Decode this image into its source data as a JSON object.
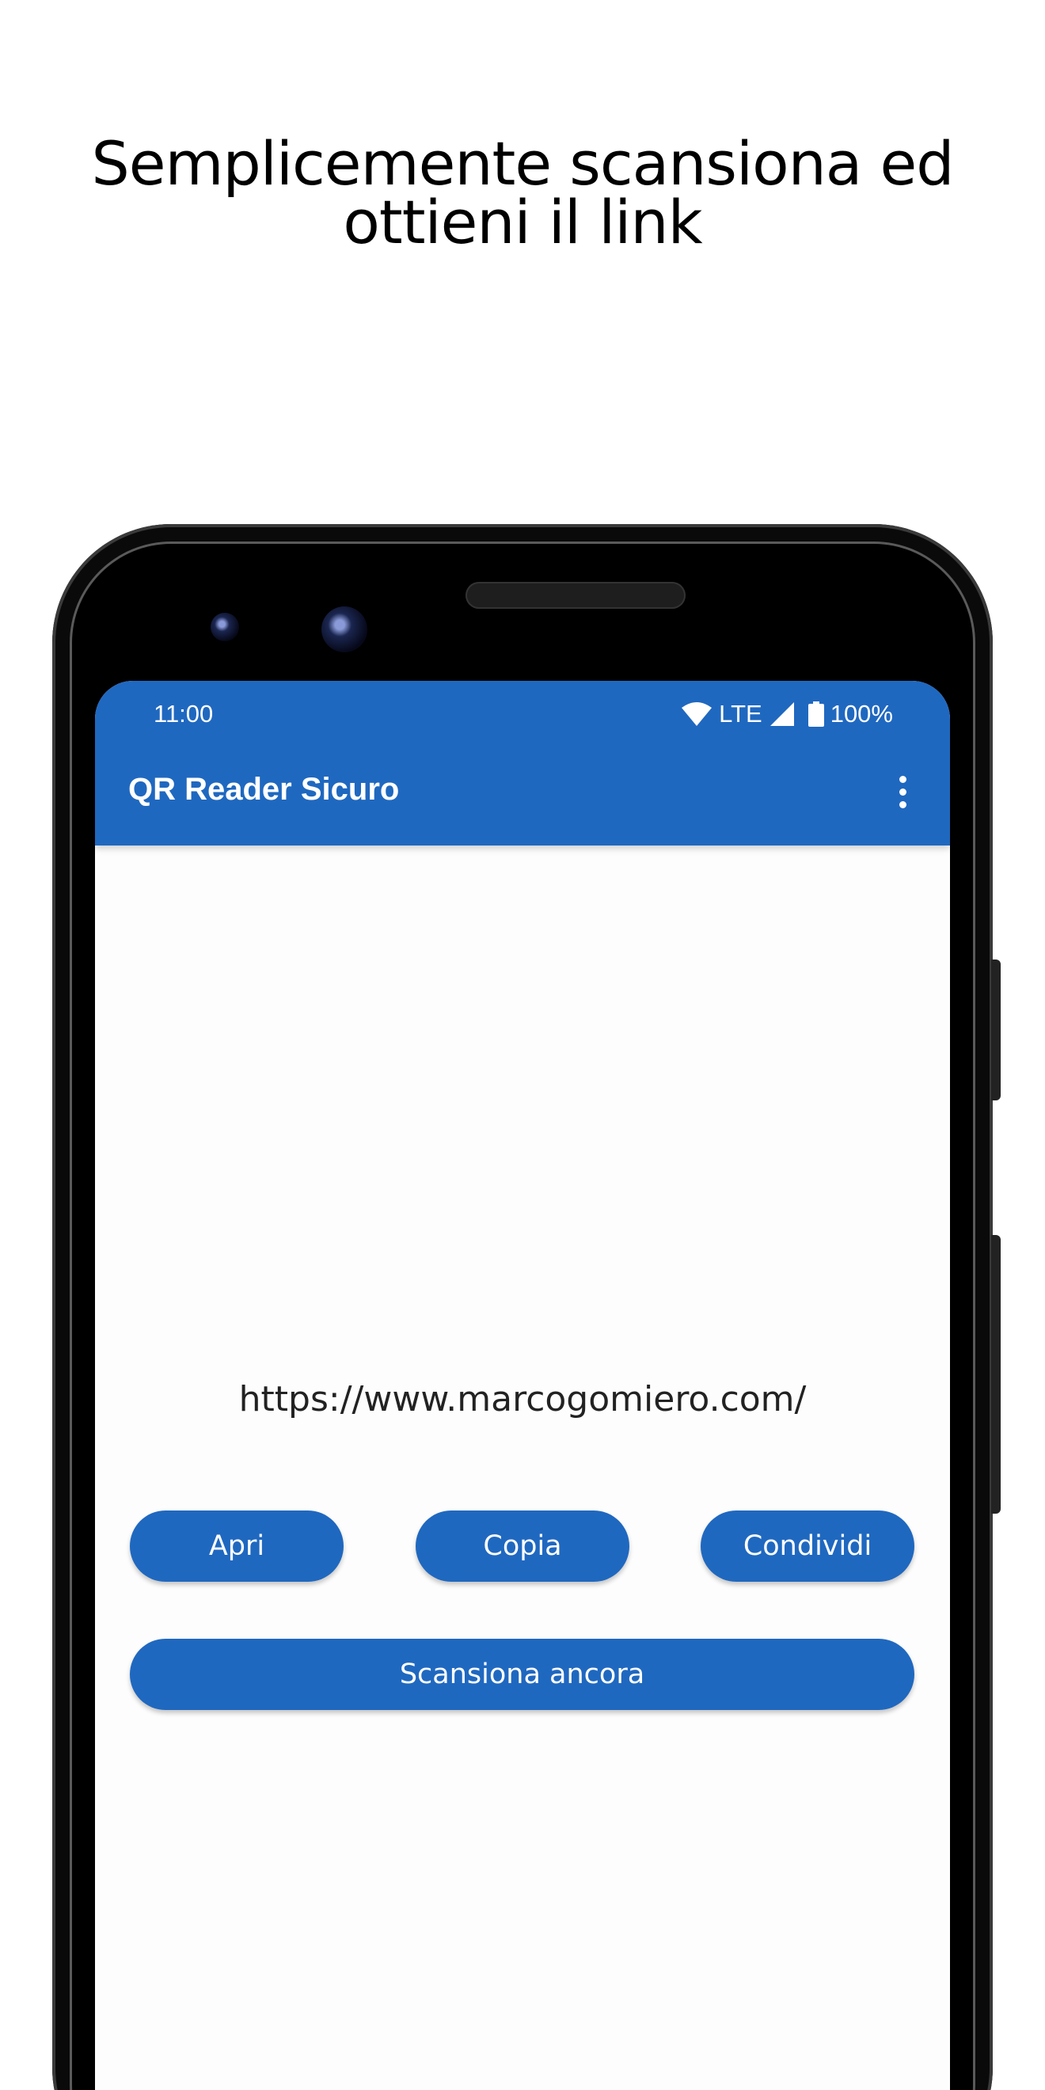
{
  "headline": {
    "line1": "Semplicemente scansiona ed",
    "line2": "ottieni il link"
  },
  "status_bar": {
    "time": "11:00",
    "network": "LTE",
    "battery": "100%",
    "icons": [
      "wifi-icon",
      "signal-icon",
      "battery-icon"
    ]
  },
  "app_bar": {
    "title": "QR Reader Sicuro",
    "menu_icon": "more-vert-icon"
  },
  "result": {
    "url": "https://www.marcogomiero.com/"
  },
  "actions": {
    "open_label": "Apri",
    "copy_label": "Copia",
    "share_label": "Condividi",
    "scan_again_label": "Scansiona ancora"
  },
  "colors": {
    "primary": "#1f68c0",
    "background": "#ffffff",
    "screen_background": "#fdfdfd",
    "on_primary": "#ffffff"
  }
}
